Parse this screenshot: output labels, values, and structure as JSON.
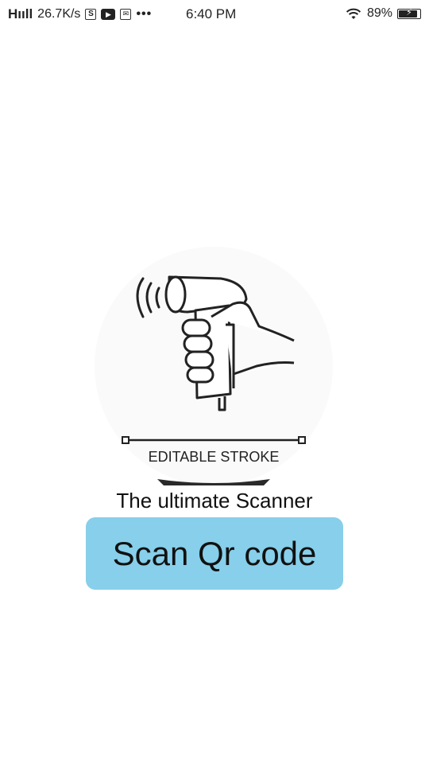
{
  "status_bar": {
    "signal": "Hııll",
    "speed": "26.7K/s",
    "s_icon_label": "S",
    "dots": "•••",
    "time": "6:40 PM",
    "battery_percent": "89%",
    "battery_level": 0.89,
    "battery_bolt": "⚡",
    "icons": [
      "signal-icon",
      "s-app-icon",
      "youtube-icon",
      "mail-icon",
      "more-dots-icon",
      "wifi-icon",
      "battery-icon"
    ]
  },
  "illustration": {
    "icon": "barcode-scanner-hand-icon",
    "caption": "EDITABLE STROKE"
  },
  "main": {
    "tagline": "The ultimate Scanner",
    "scan_button_label": "Scan Qr code"
  },
  "colors": {
    "button_bg": "#87cfea",
    "text": "#111111",
    "background": "#ffffff"
  }
}
